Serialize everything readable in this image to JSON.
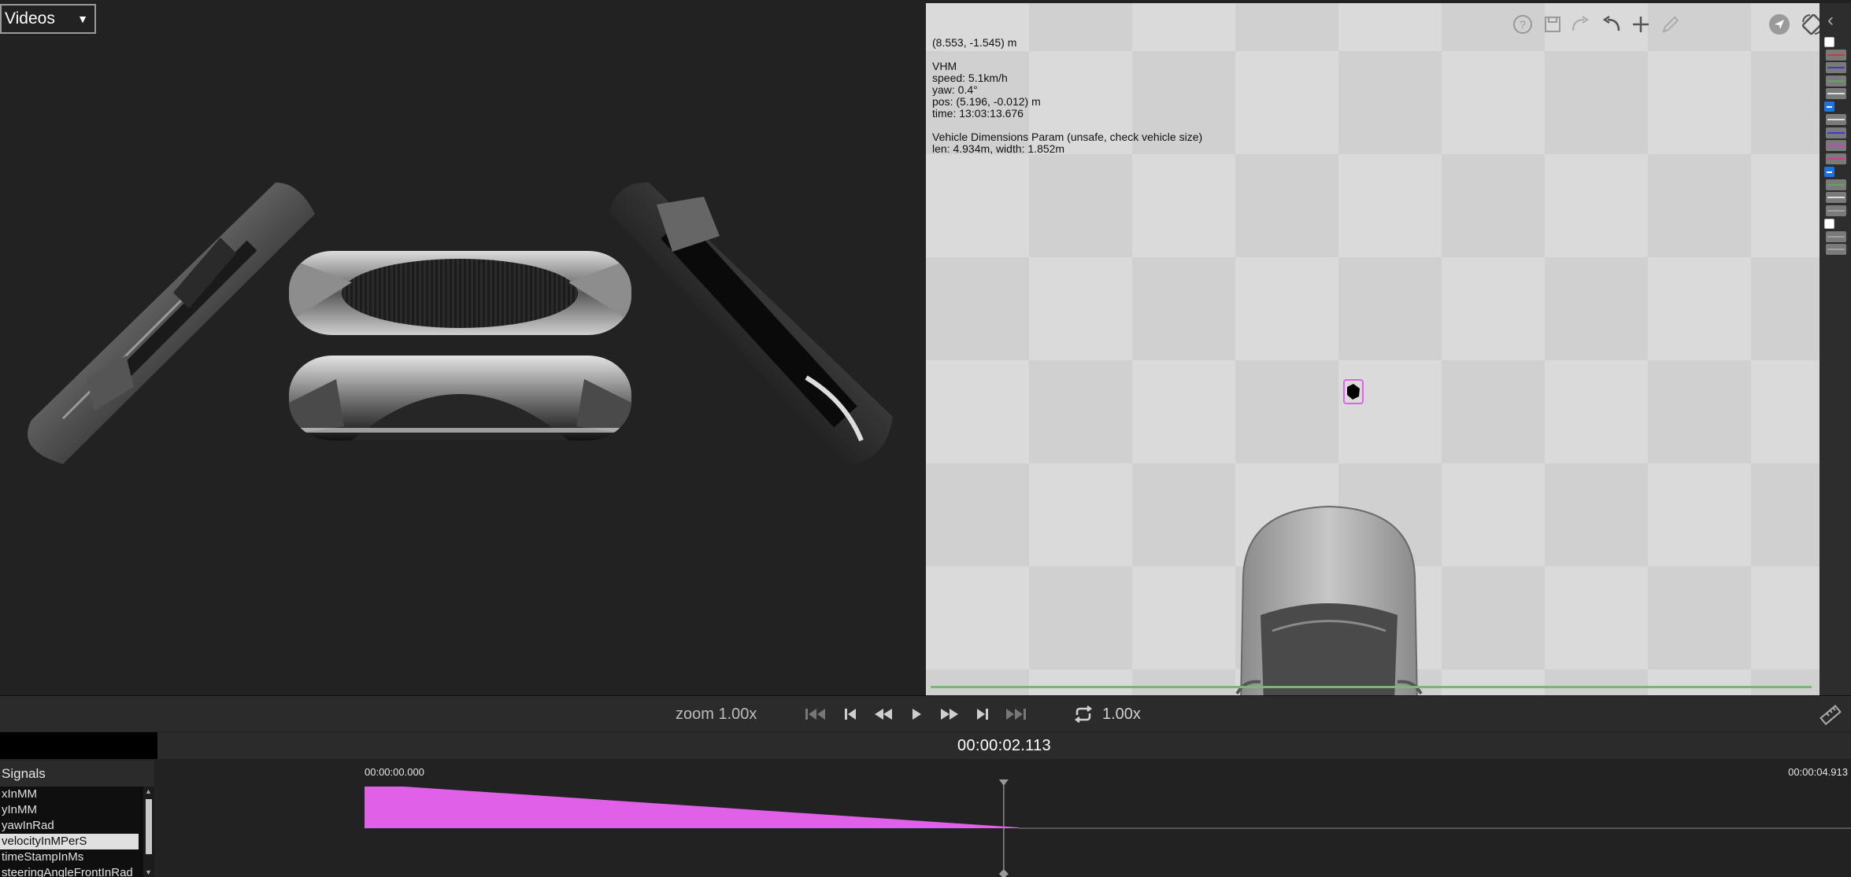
{
  "video": {
    "source_select": "Videos"
  },
  "map": {
    "cursor_coords": "(8.553, -1.545) m",
    "vehicle_model": "VHM",
    "speed": "speed: 5.1km/h",
    "yaw": "yaw: 0.4°",
    "position": "pos: (5.196, -0.012) m",
    "time": "time: 13:03:13.676",
    "dimensions_title": "Vehicle Dimensions Param (unsafe, check vehicle size)",
    "dimensions_value": "len: 4.934m, width: 1.852m",
    "toolbar_icons": [
      "help-icon",
      "save-icon",
      "redo-icon",
      "undo-icon",
      "add-icon",
      "pencil-icon",
      "locate-icon",
      "rotate-icon"
    ]
  },
  "layers": [
    {
      "type": "checkbox",
      "checked": false,
      "color": "#ffffff"
    },
    {
      "type": "swatch",
      "color": "#cc3b3b"
    },
    {
      "type": "swatch",
      "color": "#3b3bcc"
    },
    {
      "type": "swatch",
      "color": "#5aa85a"
    },
    {
      "type": "swatch",
      "color": "#dddddd"
    },
    {
      "type": "checkbox",
      "checked": true,
      "color": "#1a73e8"
    },
    {
      "type": "swatch",
      "color": "#dddddd"
    },
    {
      "type": "swatch",
      "color": "#3b3bcc"
    },
    {
      "type": "swatch",
      "color": "#d23ad2"
    },
    {
      "type": "swatch",
      "color": "#d23a8a"
    },
    {
      "type": "checkbox",
      "checked": true,
      "color": "#1a73e8"
    },
    {
      "type": "swatch",
      "color": "#5aa85a"
    },
    {
      "type": "swatch",
      "color": "#dddddd"
    },
    {
      "type": "swatch",
      "color": "#a0a0a0"
    },
    {
      "type": "checkbox",
      "checked": false,
      "color": "#ffffff"
    },
    {
      "type": "swatch",
      "color": "#a0a0a0"
    },
    {
      "type": "swatch",
      "color": "#a0a0a0"
    }
  ],
  "controls": {
    "zoom": "zoom 1.00x",
    "speed": "1.00x",
    "buttons": [
      "skip-start-icon",
      "step-back-icon",
      "rewind-icon",
      "play-icon",
      "fast-forward-icon",
      "step-forward-icon",
      "skip-end-icon",
      "loop-icon"
    ]
  },
  "timeline": {
    "current_time": "00:00:02.113",
    "start_time": "00:00:00.000",
    "end_time": "00:00:04.913",
    "playhead_fraction": 0.43
  },
  "signals": {
    "title": "Signals",
    "items": [
      "xInMM",
      "yInMM",
      "yawInRad",
      "velocityInMPerS",
      "timeStampInMs",
      "steeringAngleFrontInRad"
    ],
    "selected_index": 3
  },
  "plot": {
    "series_color": "#e060e8",
    "signal": "velocityInMPerS",
    "start_value": 1.0,
    "end_value": 0.0,
    "end_fraction": 0.44
  }
}
